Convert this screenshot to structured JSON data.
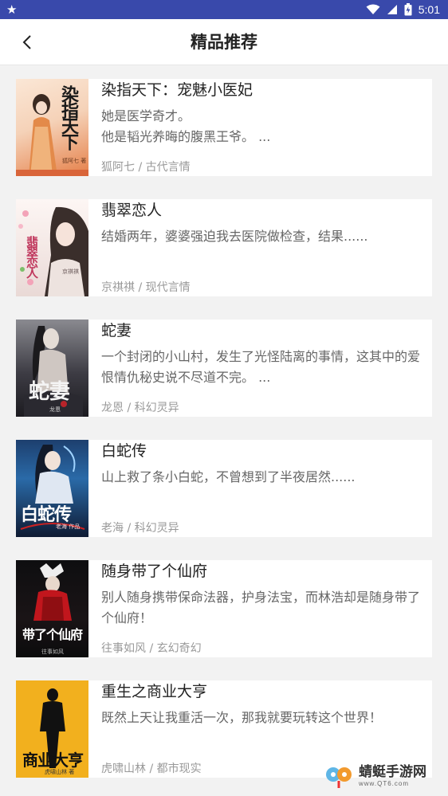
{
  "status_bar": {
    "time": "5:01",
    "icons": [
      "star-icon",
      "wifi-icon",
      "signal-icon",
      "battery-icon"
    ],
    "color": "#3949ab"
  },
  "header": {
    "title": "精品推荐",
    "back_icon": "chevron-left-icon"
  },
  "books": [
    {
      "title": "染指天下：宠魅小医妃",
      "desc": "她是医学奇才。\n他是韬光养晦的腹黑王爷。 ...",
      "meta": "狐阿七 / 古代言情",
      "cover": {
        "title": "染指天下",
        "sub": "狐阿七 著"
      }
    },
    {
      "title": "翡翠恋人",
      "desc": "结婚两年，婆婆强迫我去医院做检查，结果......",
      "meta": "京祺祺 / 现代言情",
      "cover": {
        "title": "翡翠恋人",
        "sub": "京祺祺"
      }
    },
    {
      "title": "蛇妻",
      "desc": "一个封闭的小山村，发生了光怪陆离的事情，这其中的爱恨情仇秘史说不尽道不完。 ...",
      "meta": "龙恩 / 科幻灵异",
      "cover": {
        "title": "蛇妻",
        "sub": "龙恩"
      }
    },
    {
      "title": "白蛇传",
      "desc": "山上救了条小白蛇，不曾想到了半夜居然......",
      "meta": "老海 / 科幻灵异",
      "cover": {
        "title": "白蛇传",
        "sub": "老海 作品"
      }
    },
    {
      "title": "随身带了个仙府",
      "desc": "别人随身携带保命法器，护身法宝，而林浩却是随身带了个仙府！",
      "meta": "往事如风 / 玄幻奇幻",
      "cover": {
        "title": "带了个仙府",
        "sub": "往事如风"
      }
    },
    {
      "title": "重生之商业大亨",
      "desc": "既然上天让我重活一次，那我就要玩转这个世界！",
      "meta": "虎啸山林 / 都市现实",
      "cover": {
        "title": "商业大亨",
        "sub": "虎啸山林 著"
      }
    }
  ],
  "watermark": {
    "text": "蜻蜓手游网",
    "url": "www.QT6.com"
  }
}
